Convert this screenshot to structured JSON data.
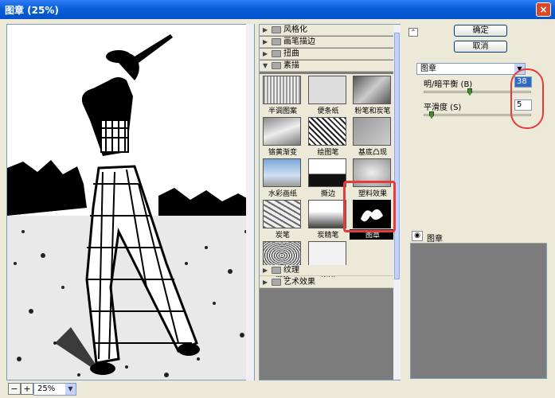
{
  "window": {
    "title": "图章 (25%)",
    "close": "×"
  },
  "preview": {
    "zoom_value": "25%"
  },
  "gallery": {
    "categories_top": [
      "风格化",
      "画笔描边",
      "扭曲",
      "素描"
    ],
    "filters": [
      {
        "label": "半调图案"
      },
      {
        "label": "便条纸"
      },
      {
        "label": "粉笔和炭笔"
      },
      {
        "label": "铬黄渐变"
      },
      {
        "label": "绘图笔"
      },
      {
        "label": "基底凸现"
      },
      {
        "label": "水彩画纸"
      },
      {
        "label": "撕边"
      },
      {
        "label": "塑料效果"
      },
      {
        "label": "炭笔"
      },
      {
        "label": "炭精笔"
      },
      {
        "label": "图章",
        "selected": true
      },
      {
        "label": "网状"
      },
      {
        "label": "影印"
      }
    ],
    "categories_bottom": [
      "纹理",
      "艺术效果"
    ]
  },
  "right_panel": {
    "ok_button": "确定",
    "cancel_button": "取消",
    "filter_select": "图章",
    "param1_label": "明/暗平衡 (B)",
    "param1_value": "38",
    "param2_label": "平滑度 (S)",
    "param2_value": "5",
    "layer_label": "图章"
  },
  "colors": {
    "title_bar": "#0a5fd9",
    "highlight_annotation": "#e53b3b",
    "selection": "#316ac5"
  }
}
